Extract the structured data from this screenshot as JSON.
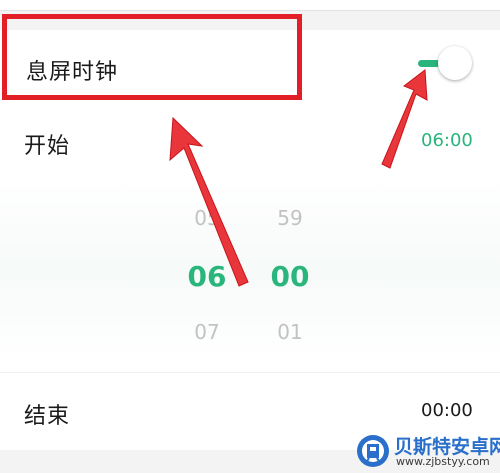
{
  "settings": {
    "aod_clock_label": "息屏时钟",
    "aod_clock_enabled": true,
    "start_label": "开始",
    "start_value": "06:00",
    "end_label": "结束",
    "end_value": "00:00"
  },
  "picker": {
    "hour_prev": "05",
    "hour_selected": "06",
    "hour_next": "07",
    "minute_prev": "59",
    "minute_selected": "00",
    "minute_next": "01"
  },
  "watermark": {
    "title": "贝斯特安卓网",
    "url": "www.zjbstyy.com"
  },
  "colors": {
    "accent": "#2ab57d",
    "annotation_red": "#e21f26"
  },
  "icons": {
    "toggle": "toggle-switch-icon",
    "watermark_logo": "watermark-logo-icon"
  }
}
